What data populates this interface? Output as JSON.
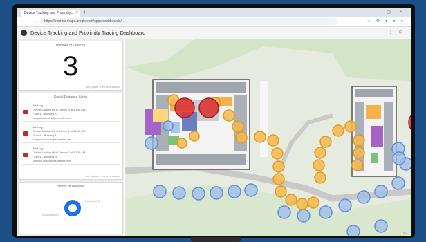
{
  "browser": {
    "tab_title": "Device Tracking and Proximity…",
    "tab_close": "×",
    "new_tab": "+",
    "window_controls": "– ▢ ×",
    "nav_buttons": "← → ⟳",
    "url": "https://indoors.maps.arcgis.com/apps/dashboards/…",
    "extensions": "☆ ⚙ ● ● ●"
  },
  "header": {
    "title": "Device Tracking and Proximity Tracing Dashboard",
    "icons": "⋮ ⊡"
  },
  "panel_count": {
    "title": "Number of Devices",
    "value": "3",
    "footer": "Last update: a few seconds ago"
  },
  "panel_alerts": {
    "title": "Social Distance Alerts",
    "footer": "Last update: a few seconds ago",
    "items": [
      {
        "name": "Alert log",
        "line1": "Device 2 within 6ft of Device 3 at 10:45 AM",
        "line2": "Floor 1 – Building A",
        "line3": "campus.indoors@example.com"
      },
      {
        "name": "Alert log",
        "line1": "Device 1 within 6ft of Device 2 at 10:41 AM",
        "line2": "Floor 1 – Building A",
        "line3": "campus.indoors@example.com"
      },
      {
        "name": "Alert log",
        "line1": "Device 1 within 6ft of Device 3 at 10:38 AM",
        "line2": "Floor 1 – Building B",
        "line3": "campus.indoors@example.com"
      }
    ]
  },
  "panel_status": {
    "title": "Status of Devices",
    "label_right": "Connected: 3",
    "label_left": "Disconnected: 0",
    "chart_data": {
      "type": "pie",
      "title": "Status of Devices",
      "categories": [
        "Connected",
        "Disconnected"
      ],
      "values": [
        3,
        0
      ]
    }
  },
  "colors": {
    "accent": "#1a73e8",
    "alert_red": "#c62828",
    "trace_orange": "#f5a623",
    "proximity_blue": "#5b8fd9"
  }
}
